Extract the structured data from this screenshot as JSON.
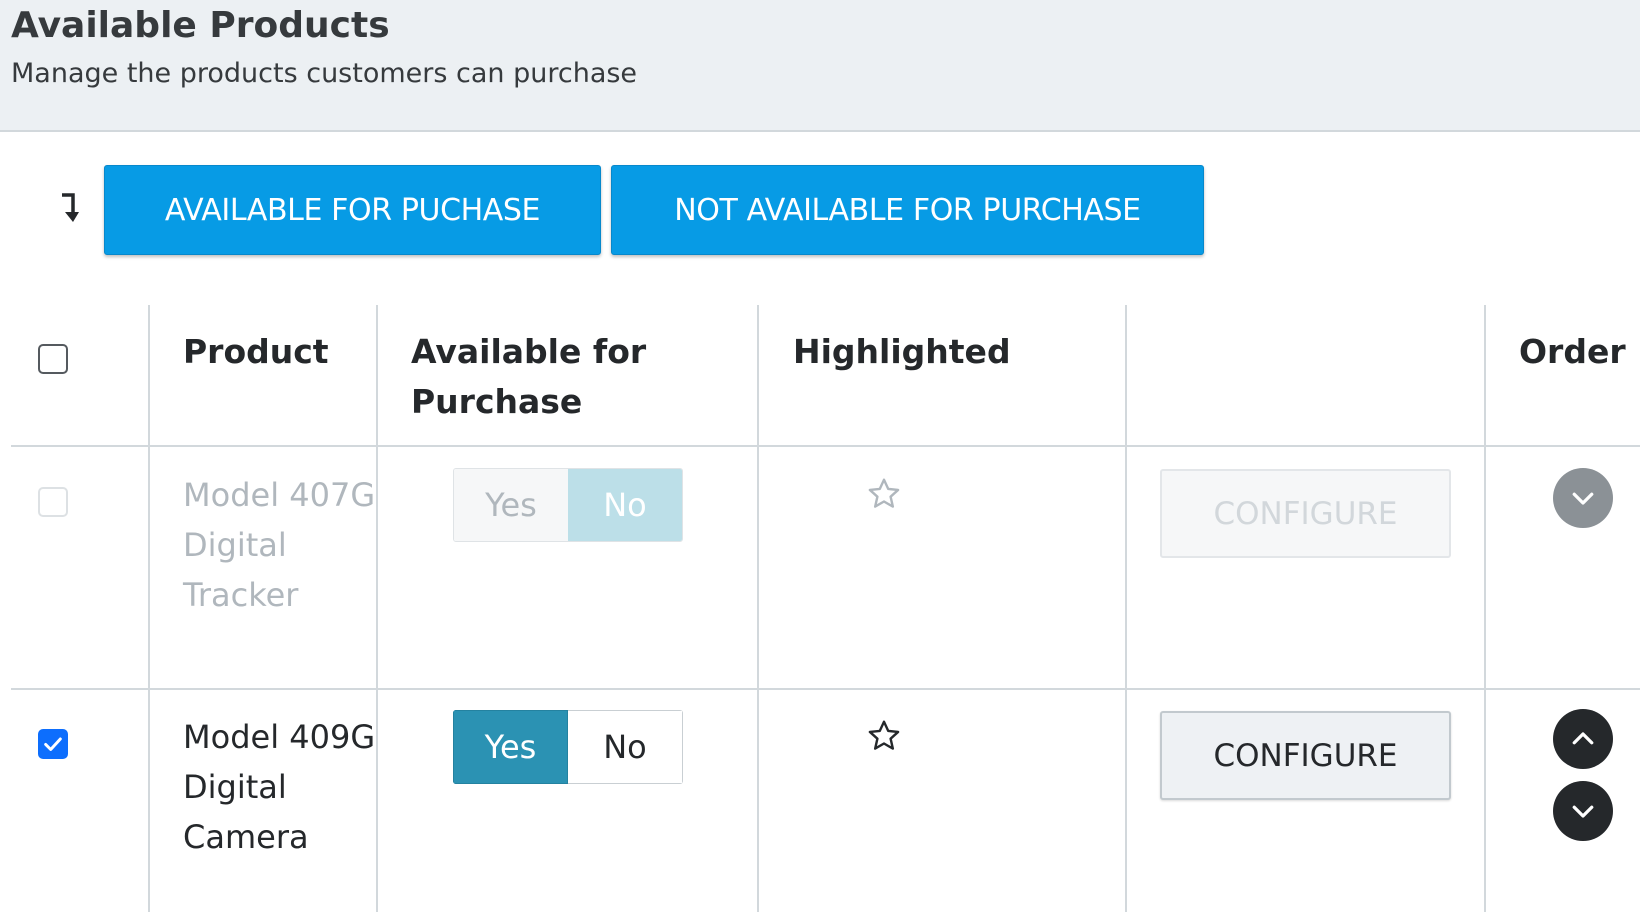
{
  "header": {
    "title": "Available Products",
    "subtitle": "Manage the products customers can purchase"
  },
  "toolbar": {
    "sort_icon": "sort-down-arrow-icon",
    "available_button": "AVAILABLE FOR PUCHASE",
    "not_available_button": "NOT AVAILABLE FOR PURCHASE",
    "accent_color": "#079be5"
  },
  "table": {
    "columns": {
      "select": "",
      "product": "Product",
      "available": "Available for Purchase",
      "highlighted": "Highlighted",
      "configure": "",
      "order": "Order"
    },
    "rows": [
      {
        "selected": false,
        "disabled": true,
        "product": "Model 407G Digital Tracker",
        "available": {
          "yes_label": "Yes",
          "no_label": "No",
          "value": "No"
        },
        "highlighted": false,
        "configure_label": "CONFIGURE",
        "order_controls": [
          "down"
        ]
      },
      {
        "selected": true,
        "disabled": false,
        "product": "Model 409G Digital Camera",
        "available": {
          "yes_label": "Yes",
          "no_label": "No",
          "value": "Yes"
        },
        "highlighted": false,
        "configure_label": "CONFIGURE",
        "order_controls": [
          "up",
          "down"
        ]
      }
    ]
  }
}
